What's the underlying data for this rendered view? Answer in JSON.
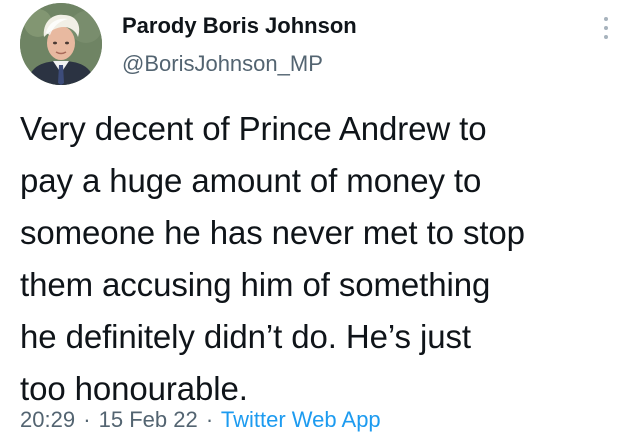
{
  "author": {
    "display_name": "Parody Boris Johnson",
    "handle": "@BorisJohnson_MP",
    "avatar_icon": "profile-photo"
  },
  "tweet": {
    "text_lines": [
      "Very decent of Prince Andrew to",
      "pay a huge amount of money to",
      "someone he has never met to stop",
      "them accusing him of something",
      "he definitely didn’t do. He’s just",
      "too honourable."
    ]
  },
  "meta": {
    "time": "20:29",
    "separator": "·",
    "date": "15 Feb 22",
    "source": "Twitter Web App"
  },
  "icons": {
    "more": "more-options-icon"
  },
  "colors": {
    "text": "#0f1419",
    "secondary": "#536471",
    "link": "#1d9bf0"
  }
}
